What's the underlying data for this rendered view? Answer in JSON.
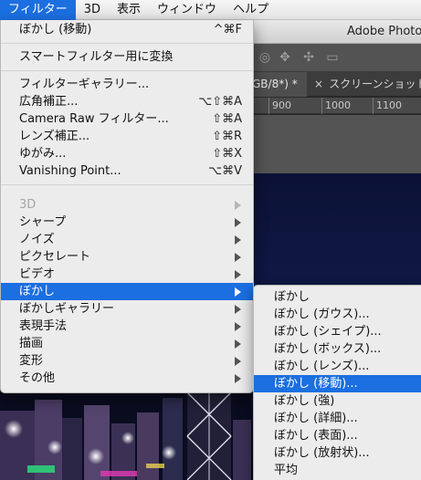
{
  "menubar": {
    "items": [
      {
        "label": "フィルター"
      },
      {
        "label": "3D"
      },
      {
        "label": "表示"
      },
      {
        "label": "ウィンドウ"
      },
      {
        "label": "ヘルプ"
      }
    ]
  },
  "app": {
    "title": "Adobe Photos",
    "tab_active": "GB/8*) *",
    "tab_inactive": "スクリーンショット",
    "ruler_ticks": [
      "900",
      "1000",
      "1100"
    ]
  },
  "filter_menu": {
    "last_filter": {
      "label": "ぼかし (移動)",
      "shortcut": "^⌘F"
    },
    "smart_filter": {
      "label": "スマートフィルター用に変換"
    },
    "filter_gallery": {
      "label": "フィルターギャラリー..."
    },
    "adaptive_wide_angle": {
      "label": "広角補正...",
      "shortcut": "⌥⇧⌘A"
    },
    "camera_raw": {
      "label": "Camera Raw フィルター...",
      "shortcut": "⇧⌘A"
    },
    "lens_correction": {
      "label": "レンズ補正...",
      "shortcut": "⇧⌘R"
    },
    "liquify": {
      "label": "ゆがみ...",
      "shortcut": "⇧⌘X"
    },
    "vanishing_point": {
      "label": "Vanishing Point...",
      "shortcut": "⌥⌘V"
    },
    "submenus": [
      {
        "label": "3D"
      },
      {
        "label": "シャープ"
      },
      {
        "label": "ノイズ"
      },
      {
        "label": "ピクセレート"
      },
      {
        "label": "ビデオ"
      },
      {
        "label": "ぼかし"
      },
      {
        "label": "ぼかしギャラリー"
      },
      {
        "label": "表現手法"
      },
      {
        "label": "描画"
      },
      {
        "label": "変形"
      },
      {
        "label": "その他"
      }
    ]
  },
  "blur_submenu": {
    "items": [
      {
        "label": "ぼかし"
      },
      {
        "label": "ぼかし (ガウス)..."
      },
      {
        "label": "ぼかし (シェイプ)..."
      },
      {
        "label": "ぼかし (ボックス)..."
      },
      {
        "label": "ぼかし (レンズ)..."
      },
      {
        "label": "ぼかし (移動)..."
      },
      {
        "label": "ぼかし (強)"
      },
      {
        "label": "ぼかし (詳細)..."
      },
      {
        "label": "ぼかし (表面)..."
      },
      {
        "label": "ぼかし (放射状)..."
      },
      {
        "label": "平均"
      }
    ]
  },
  "colors": {
    "highlight": "#1b6fe0",
    "menu_bg": "#ececec"
  }
}
